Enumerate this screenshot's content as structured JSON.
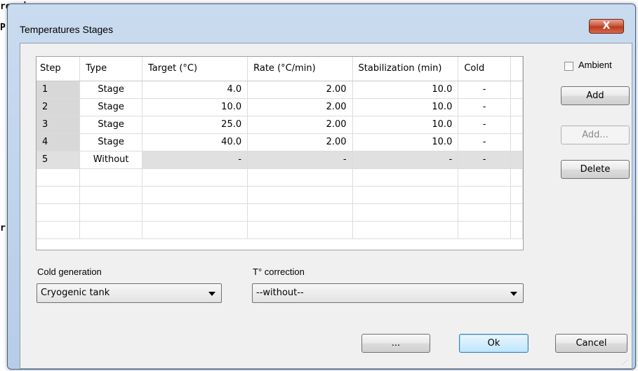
{
  "background": {
    "line1": "ression",
    "line2": "P",
    "line3": "r"
  },
  "window": {
    "title": "Temperatures Stages",
    "close_glyph": "X"
  },
  "table": {
    "headers": [
      "Step",
      "Type",
      "Target (°C)",
      "Rate (°C/min)",
      "Stabilization (min)",
      "Cold"
    ],
    "rows": [
      {
        "step": "1",
        "type": "Stage",
        "target": "4.0",
        "rate": "2.00",
        "stab": "10.0",
        "cold": "-"
      },
      {
        "step": "2",
        "type": "Stage",
        "target": "10.0",
        "rate": "2.00",
        "stab": "10.0",
        "cold": "-"
      },
      {
        "step": "3",
        "type": "Stage",
        "target": "25.0",
        "rate": "2.00",
        "stab": "10.0",
        "cold": "-"
      },
      {
        "step": "4",
        "type": "Stage",
        "target": "40.0",
        "rate": "2.00",
        "stab": "10.0",
        "cold": "-"
      },
      {
        "step": "5",
        "type": "Without",
        "target": "-",
        "rate": "-",
        "stab": "-",
        "cold": "-"
      }
    ]
  },
  "side": {
    "ambient_label": "Ambient",
    "ambient_checked": false,
    "add_label": "Add",
    "add_more_label": "Add...",
    "delete_label": "Delete"
  },
  "cold_generation": {
    "label": "Cold generation",
    "value": "Cryogenic tank"
  },
  "t_correction": {
    "label": "T° correction",
    "value": "--without--"
  },
  "footer": {
    "more_label": "...",
    "ok_label": "Ok",
    "cancel_label": "Cancel"
  },
  "colors": {
    "title_gradient": "#c9dbef",
    "close_red": "#c75135",
    "client_bg": "#f0f0f0"
  }
}
